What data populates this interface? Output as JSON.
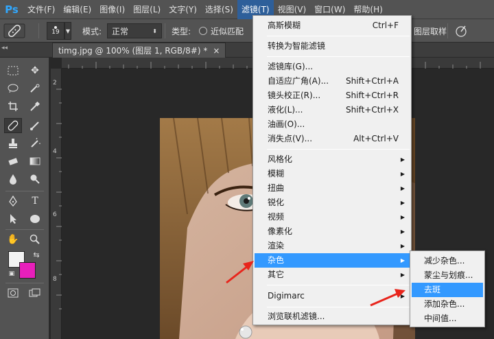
{
  "app": {
    "logo": "Ps"
  },
  "menubar": {
    "items": [
      "文件(F)",
      "编辑(E)",
      "图像(I)",
      "图层(L)",
      "文字(Y)",
      "选择(S)",
      "滤镜(T)",
      "视图(V)",
      "窗口(W)",
      "帮助(H)"
    ],
    "active_index": 6
  },
  "options": {
    "brush_size": "19",
    "mode_label": "模式:",
    "mode_value": "正常",
    "type_label": "类型:",
    "type_option": "近似匹配",
    "sample_label": "图层取样"
  },
  "document": {
    "tab_title": "timg.jpg @ 100% (图层 1, RGB/8#) *",
    "close_glyph": "×"
  },
  "rulers": {
    "left_numbers": [
      "2",
      "4",
      "6",
      "8"
    ]
  },
  "colors": {
    "foreground": "#f2f2f2",
    "background": "#e81fbb",
    "menu_highlight": "#3399ff",
    "annotation_arrow": "#e8251c"
  },
  "filter_menu": {
    "last_filter": {
      "label": "高斯模糊",
      "shortcut": "Ctrl+F"
    },
    "smart": {
      "label": "转换为智能滤镜"
    },
    "main_filters": [
      {
        "label": "滤镜库(G)...",
        "shortcut": ""
      },
      {
        "label": "自适应广角(A)...",
        "shortcut": "Shift+Ctrl+A"
      },
      {
        "label": "镜头校正(R)...",
        "shortcut": "Shift+Ctrl+R"
      },
      {
        "label": "液化(L)...",
        "shortcut": "Shift+Ctrl+X"
      },
      {
        "label": "油画(O)...",
        "shortcut": ""
      },
      {
        "label": "消失点(V)...",
        "shortcut": "Alt+Ctrl+V"
      }
    ],
    "submenus": [
      "风格化",
      "模糊",
      "扭曲",
      "锐化",
      "视频",
      "像素化",
      "渲染",
      "杂色",
      "其它"
    ],
    "highlighted_submenu": "杂色",
    "digimarc": {
      "label": "Digimarc"
    },
    "browse": {
      "label": "浏览联机滤镜..."
    }
  },
  "noise_submenu": {
    "items": [
      "减少杂色...",
      "蒙尘与划痕...",
      "去斑",
      "添加杂色...",
      "中间值..."
    ],
    "highlighted": "去斑"
  }
}
